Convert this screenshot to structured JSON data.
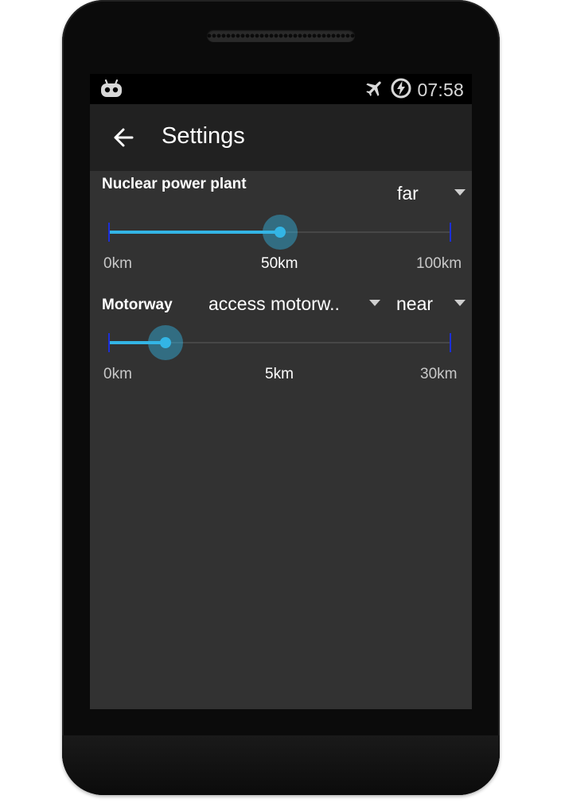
{
  "statusbar": {
    "time": "07:58",
    "icons": [
      "cyanogen-robot-icon",
      "airplane-mode-icon",
      "battery-charging-icon"
    ]
  },
  "appbar": {
    "title": "Settings",
    "back_icon": "arrow-left-icon"
  },
  "rows": [
    {
      "label": "Nuclear power plant",
      "distance_spinner": "far",
      "slider": {
        "min_label": "0km",
        "mid_label": "50km",
        "max_label": "100km",
        "min": 0,
        "max": 100,
        "value": 50
      }
    },
    {
      "label": "Motorway",
      "type_spinner": "access motorw..",
      "distance_spinner": "near",
      "slider": {
        "min_label": "0km",
        "mid_label": "5km",
        "max_label": "30km",
        "min": 0,
        "max": 30,
        "value": 5
      }
    }
  ],
  "colors": {
    "accent": "#33b5e5",
    "tick": "#1c2fd8",
    "background": "#323232",
    "appbar": "#212121"
  }
}
